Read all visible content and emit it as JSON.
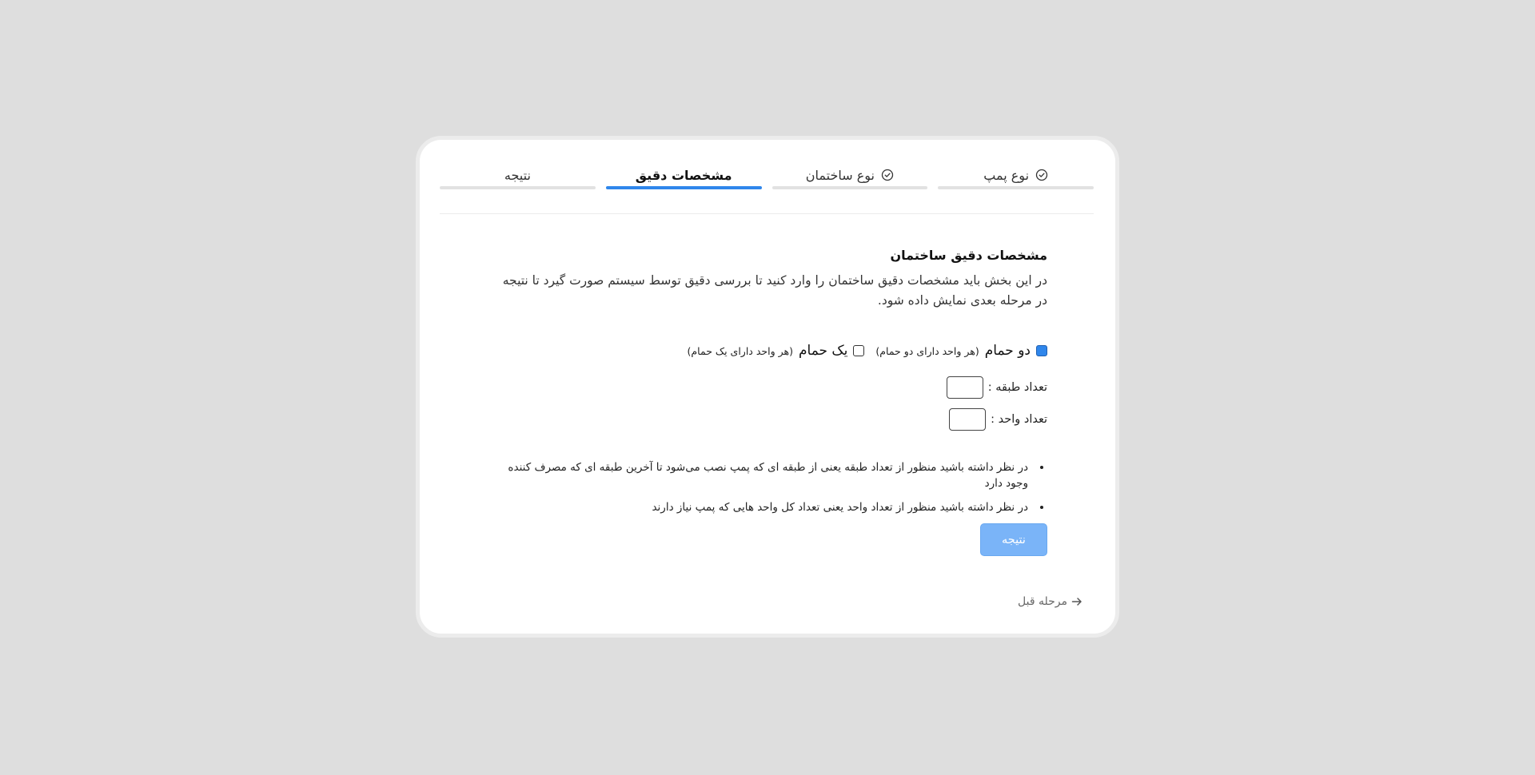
{
  "steps": [
    {
      "label": "نوع پمپ",
      "completed": true,
      "active": false
    },
    {
      "label": "نوع ساختمان",
      "completed": true,
      "active": false
    },
    {
      "label": "مشخصات دقیق",
      "completed": false,
      "active": true
    },
    {
      "label": "نتیجه",
      "completed": false,
      "active": false
    }
  ],
  "section": {
    "title": "مشخصات دقیق ساختمان",
    "description": "در این بخش باید مشخصات دقیق ساختمان را وارد کنید تا بررسی دقیق توسط سیستم صورت گیرد تا نتیجه در مرحله بعدی نمایش داده شود."
  },
  "options": {
    "two_bath": {
      "label": "دو حمام",
      "hint": "(هر واحد دارای دو حمام)",
      "checked": true
    },
    "one_bath": {
      "label": "یک حمام",
      "hint": "(هر واحد دارای یک حمام)",
      "checked": false
    }
  },
  "fields": {
    "floors": {
      "label": "تعداد طبقه :",
      "value": ""
    },
    "units": {
      "label": "تعداد واحد :",
      "value": ""
    }
  },
  "notes": [
    "در نظر داشته باشید منظور از تعداد طبقه یعنی از طبقه ای که پمپ نصب می‌شود تا آخرین طبقه ای که مصرف کننده وجود دارد",
    "در نظر داشته باشید منظور از تعداد واحد یعنی تعداد کل واحد هایی که پمپ نیاز دارند"
  ],
  "actions": {
    "result_label": "نتیجه",
    "back_label": "مرحله قبل"
  },
  "colors": {
    "accent": "#2f86eb",
    "button": "#7ab4f8",
    "background": "#dedede"
  }
}
